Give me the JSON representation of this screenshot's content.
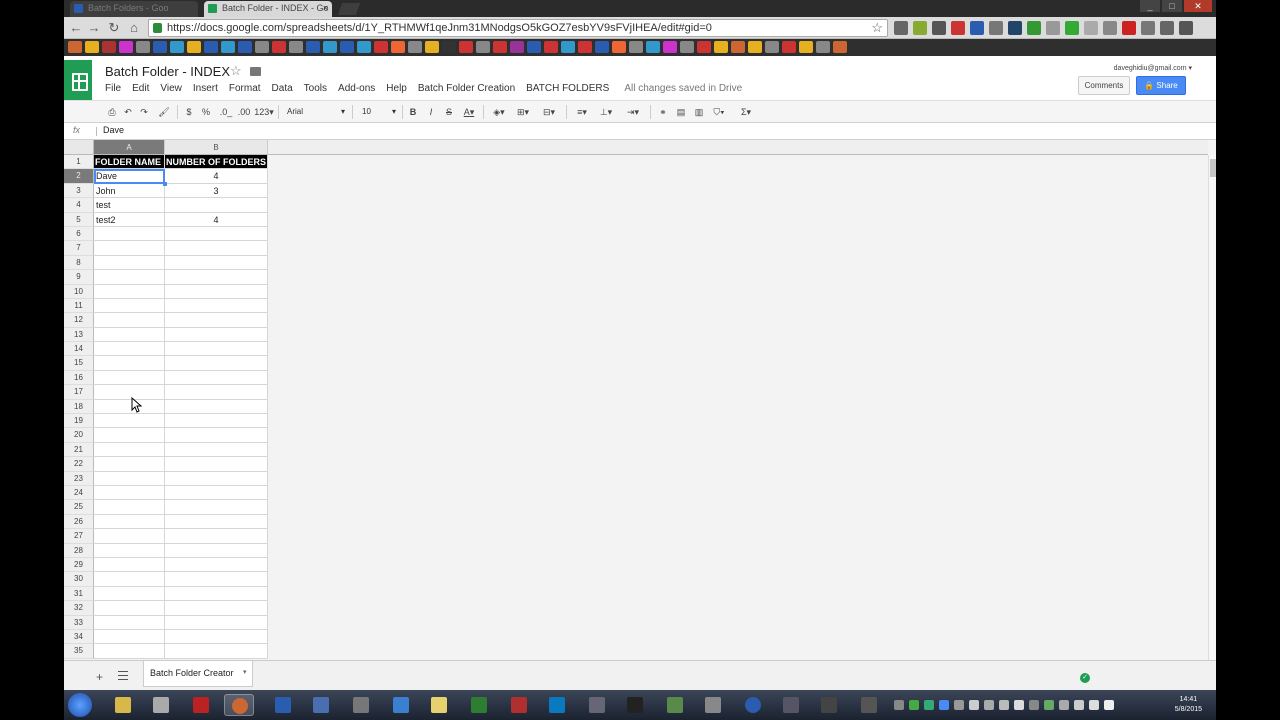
{
  "browser": {
    "tabs": [
      {
        "title": "Batch Folders - Goo",
        "active": false
      },
      {
        "title": "Batch Folder - INDEX - Go",
        "active": true
      }
    ],
    "url": "https://docs.google.com/spreadsheets/d/1Y_RTHMWf1qeJnm31MNodgsO5kGOZ7esbYV9sFVjIHEA/edit#gid=0",
    "close_glyph": "×",
    "star_glyph": "☆"
  },
  "docs": {
    "title": "Batch Folder - INDEX",
    "account": "daveghidiu@gmail.com",
    "menu": [
      "File",
      "Edit",
      "View",
      "Insert",
      "Format",
      "Data",
      "Tools",
      "Add-ons",
      "Help",
      "Batch Folder Creation",
      "BATCH FOLDERS"
    ],
    "save_status": "All changes saved in Drive",
    "comments_label": "Comments",
    "share_label": "Share"
  },
  "toolbar": {
    "currency": "$",
    "percent": "%",
    "dec_decrease": ".0_",
    "dec_increase": ".00",
    "more_formats": "123",
    "font": "Arial",
    "font_size": "10",
    "bold": "B",
    "italic": "I",
    "strike": "S",
    "text_color": "A",
    "sum": "Σ"
  },
  "formula_bar": {
    "fx": "fx",
    "value": "Dave"
  },
  "sheet": {
    "columns": [
      "A",
      "B"
    ],
    "header_row": {
      "a": "FOLDER NAME",
      "b": "NUMBER OF FOLDERS"
    },
    "rows": [
      {
        "n": "1"
      },
      {
        "n": "2",
        "a": "Dave",
        "b": "4"
      },
      {
        "n": "3",
        "a": "John",
        "b": "3"
      },
      {
        "n": "4",
        "a": "test",
        "b": ""
      },
      {
        "n": "5",
        "a": "test2",
        "b": "4"
      }
    ],
    "empty_row_numbers": [
      "6",
      "7",
      "8",
      "9",
      "10",
      "11",
      "12",
      "13",
      "14",
      "15",
      "16",
      "17",
      "18",
      "19",
      "20",
      "21",
      "22",
      "23",
      "24",
      "25",
      "26",
      "27",
      "28",
      "29",
      "30",
      "31",
      "32",
      "33",
      "34",
      "35"
    ],
    "active_cell": "A2"
  },
  "sheet_tabs": {
    "add": "+",
    "tabs": [
      "Batch Folder Creator"
    ],
    "caret": "▾"
  },
  "taskbar": {
    "time": "14:41",
    "date": "5/8/2015"
  },
  "colors": {
    "sheets_green": "#1f9d55",
    "share_blue": "#4a8af4",
    "header_black": "#000000",
    "selection_blue": "#4a8af4"
  }
}
